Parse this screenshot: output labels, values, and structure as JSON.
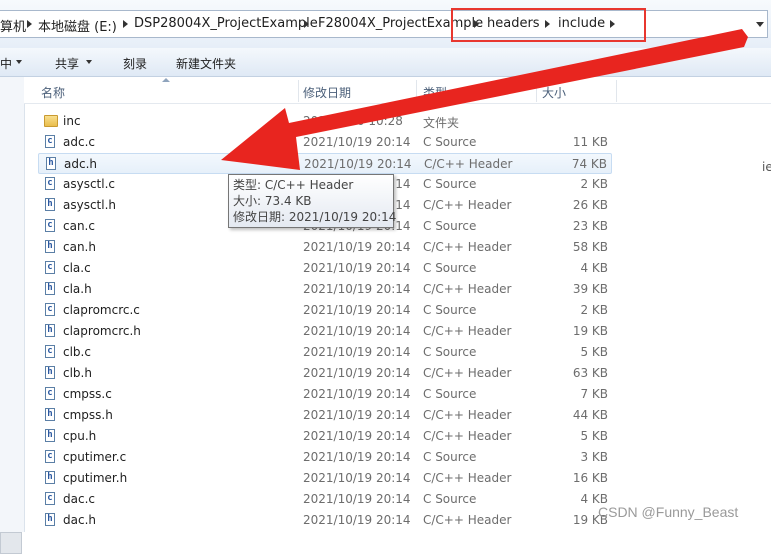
{
  "breadcrumb": {
    "items": [
      "算机",
      "本地磁盘 (E:)",
      "DSP28004X_ProjectExample",
      "F28004X_ProjectExample",
      "headers",
      "include"
    ]
  },
  "toolbar": {
    "organize": "中",
    "share": "共享",
    "burn": "刻录",
    "new_folder": "新建文件夹"
  },
  "columns": {
    "name": "名称",
    "date": "修改日期",
    "type": "类型",
    "size": "大小"
  },
  "files": [
    {
      "name": "inc",
      "date": "2022/7/30 10:28",
      "type": "文件夹",
      "size": "",
      "icon": "folder-icon"
    },
    {
      "name": "adc.c",
      "date": "2021/10/19 20:14",
      "type": "C Source",
      "size": "11 KB",
      "icon": "c-source-file-icon"
    },
    {
      "name": "adc.h",
      "date": "2021/10/19 20:14",
      "type": "C/C++ Header",
      "size": "74 KB",
      "icon": "c-header-file-icon"
    },
    {
      "name": "asysctl.c",
      "date": "2021/10/19 20:14",
      "type": "C Source",
      "size": "2 KB",
      "icon": "c-source-file-icon"
    },
    {
      "name": "asysctl.h",
      "date": "2021/10/19 20:14",
      "type": "C/C++ Header",
      "size": "26 KB",
      "icon": "c-header-file-icon"
    },
    {
      "name": "can.c",
      "date": "2021/10/19 20:14",
      "type": "C Source",
      "size": "23 KB",
      "icon": "c-source-file-icon"
    },
    {
      "name": "can.h",
      "date": "2021/10/19 20:14",
      "type": "C/C++ Header",
      "size": "58 KB",
      "icon": "c-header-file-icon"
    },
    {
      "name": "cla.c",
      "date": "2021/10/19 20:14",
      "type": "C Source",
      "size": "4 KB",
      "icon": "c-source-file-icon"
    },
    {
      "name": "cla.h",
      "date": "2021/10/19 20:14",
      "type": "C/C++ Header",
      "size": "39 KB",
      "icon": "c-header-file-icon"
    },
    {
      "name": "clapromcrc.c",
      "date": "2021/10/19 20:14",
      "type": "C Source",
      "size": "2 KB",
      "icon": "c-source-file-icon"
    },
    {
      "name": "clapromcrc.h",
      "date": "2021/10/19 20:14",
      "type": "C/C++ Header",
      "size": "19 KB",
      "icon": "c-header-file-icon"
    },
    {
      "name": "clb.c",
      "date": "2021/10/19 20:14",
      "type": "C Source",
      "size": "5 KB",
      "icon": "c-source-file-icon"
    },
    {
      "name": "clb.h",
      "date": "2021/10/19 20:14",
      "type": "C/C++ Header",
      "size": "63 KB",
      "icon": "c-header-file-icon"
    },
    {
      "name": "cmpss.c",
      "date": "2021/10/19 20:14",
      "type": "C Source",
      "size": "7 KB",
      "icon": "c-source-file-icon"
    },
    {
      "name": "cmpss.h",
      "date": "2021/10/19 20:14",
      "type": "C/C++ Header",
      "size": "44 KB",
      "icon": "c-header-file-icon"
    },
    {
      "name": "cpu.h",
      "date": "2021/10/19 20:14",
      "type": "C/C++ Header",
      "size": "5 KB",
      "icon": "c-header-file-icon"
    },
    {
      "name": "cputimer.c",
      "date": "2021/10/19 20:14",
      "type": "C Source",
      "size": "3 KB",
      "icon": "c-source-file-icon"
    },
    {
      "name": "cputimer.h",
      "date": "2021/10/19 20:14",
      "type": "C/C++ Header",
      "size": "16 KB",
      "icon": "c-header-file-icon"
    },
    {
      "name": "dac.c",
      "date": "2021/10/19 20:14",
      "type": "C Source",
      "size": "4 KB",
      "icon": "c-source-file-icon"
    },
    {
      "name": "dac.h",
      "date": "2021/10/19 20:14",
      "type": "C/C++ Header",
      "size": "19 KB",
      "icon": "c-header-file-icon"
    }
  ],
  "tooltip": {
    "type_line": "类型: C/C++ Header",
    "size_line": "大小: 73.4 KB",
    "date_line": "修改日期: 2021/10/19 20:14"
  },
  "annotation": {
    "highlight_color": "#e8372f",
    "arrow_color": "#e8251f"
  },
  "watermark": "CSDN @Funny_Beast",
  "right_edge_stub": "ie"
}
